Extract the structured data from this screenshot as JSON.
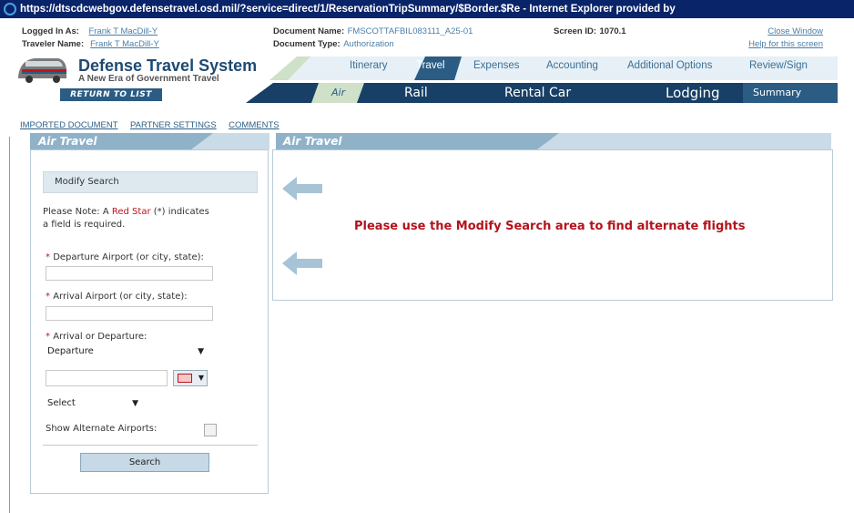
{
  "window": {
    "title": "https://dtscdcwebgov.defensetravel.osd.mil/?service=direct/1/ReservationTripSummary/$Border.$Re - Internet Explorer provided by"
  },
  "info": {
    "logged_in_label": "Logged In As:",
    "logged_in_value": "Frank T MacDill-Y",
    "traveler_label": "Traveler Name:",
    "traveler_value": "Frank T MacDill-Y",
    "doc_name_label": "Document Name:",
    "doc_name_value": "FMSCOTTAFBIL083111_A25-01",
    "doc_type_label": "Document Type:",
    "doc_type_value": "Authorization",
    "screen_id_label": "Screen ID:",
    "screen_id_value": "1070.1",
    "close_window": "Close Window",
    "help": "Help for this screen"
  },
  "brand": {
    "title": "Defense Travel System",
    "subtitle": "A New Era of Government Travel",
    "return_label": "RETURN TO LIST"
  },
  "nav": {
    "tabs": [
      "Itinerary",
      "Travel",
      "Expenses",
      "Accounting",
      "Additional Options",
      "Review/Sign"
    ],
    "active_tab": "Travel",
    "subtabs": [
      "Air",
      "Rail",
      "Rental Car",
      "Lodging",
      "Summary"
    ],
    "active_subtab": "Air"
  },
  "links": [
    "IMPORTED DOCUMENT",
    "PARTNER SETTINGS",
    "COMMENTS"
  ],
  "left_panel": {
    "title": "Air Travel",
    "modify_search": "Modify Search",
    "note_prefix": "Please Note: A ",
    "note_red": "Red Star",
    "note_suffix": " (*) indicates",
    "note_line2": "a field is required.",
    "departure_label": "Departure Airport (or city, state):",
    "arrival_label": "Arrival Airport (or city, state):",
    "arr_dep_label": "Arrival or Departure:",
    "arr_dep_value": "Departure",
    "time_value": "Select",
    "alt_airports_label": "Show Alternate Airports:",
    "search_button": "Search"
  },
  "right_panel": {
    "title": "Air Travel",
    "message": "Please use the Modify Search area to find alternate flights"
  },
  "colors": {
    "title_bar": "#0a246a",
    "nav_dark": "#183f66",
    "panel_header": "#8fb2c9",
    "error_red": "#b3131b",
    "link_blue": "#2c5f86"
  }
}
